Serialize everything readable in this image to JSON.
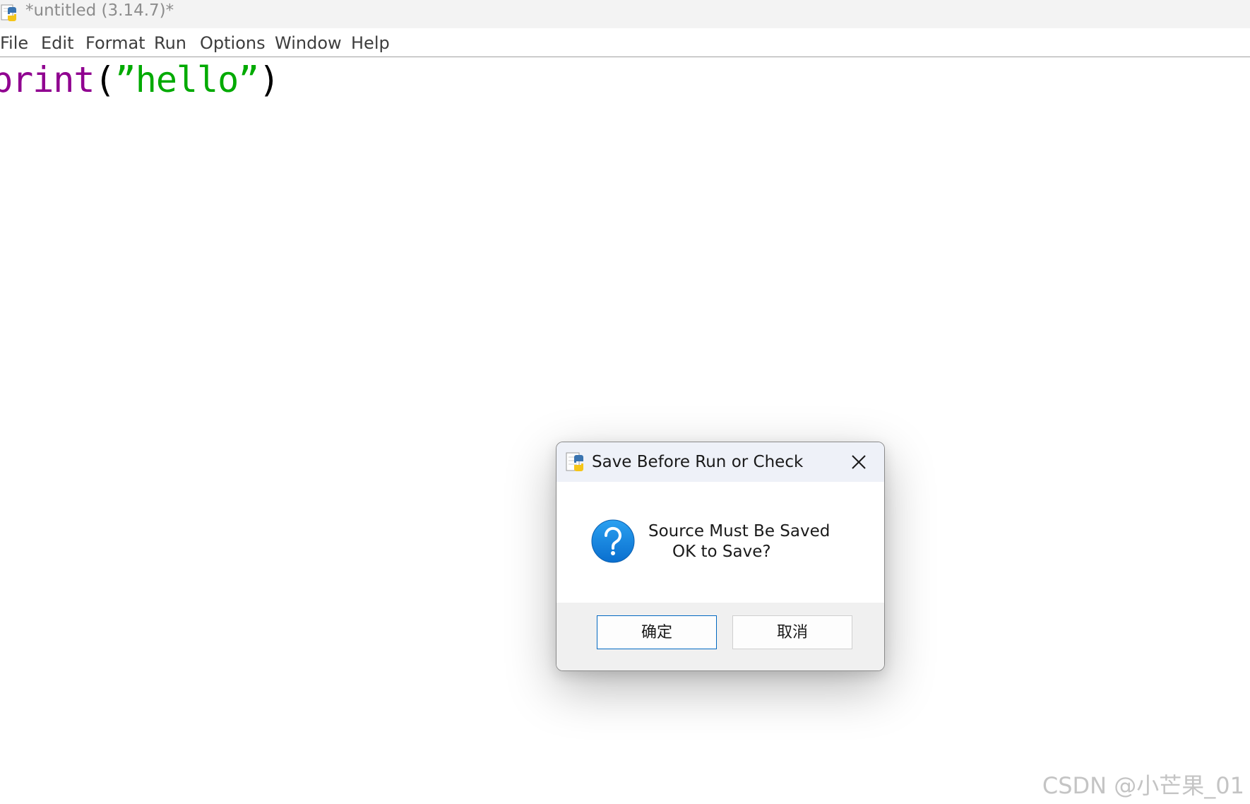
{
  "window": {
    "title": "*untitled (3.14.7)*",
    "icon": "python-idle-icon"
  },
  "menu": {
    "items": [
      "File",
      "Edit",
      "Format",
      "Run",
      "Options",
      "Window",
      "Help"
    ]
  },
  "editor": {
    "tokens": [
      {
        "text": "print",
        "kind": "builtin"
      },
      {
        "text": "(",
        "kind": "paren"
      },
      {
        "text": "”hello”",
        "kind": "string"
      },
      {
        "text": ")",
        "kind": "paren"
      }
    ],
    "colors": {
      "builtin": "#900090",
      "string": "#00aa00",
      "paren": "#000000"
    }
  },
  "dialog": {
    "title": "Save Before Run or Check",
    "icon": "question-icon",
    "message_line1": "Source Must Be Saved",
    "message_line2": "OK to Save?",
    "ok_label": "确定",
    "cancel_label": "取消",
    "accent": "#0067c0"
  },
  "watermark": "CSDN @小芒果_01"
}
